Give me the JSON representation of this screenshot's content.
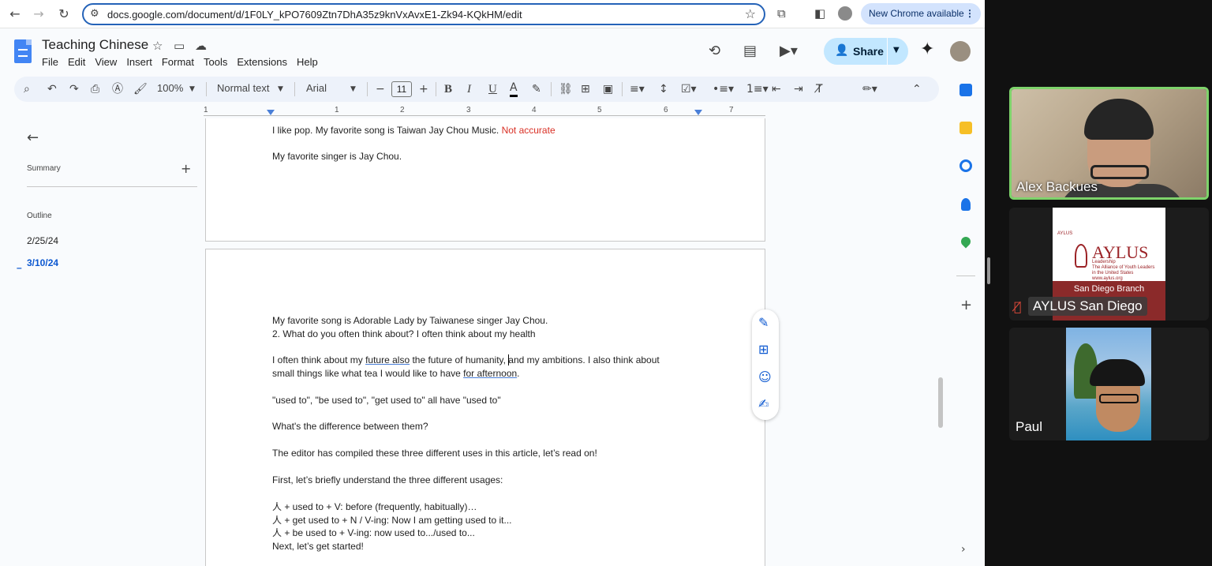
{
  "browser": {
    "url": "docs.google.com/document/d/1F0LY_kPO7609Ztn7DhA35z9knVxAvxE1-Zk94-KQkHM/edit",
    "new_chrome_label": "New Chrome available"
  },
  "doc": {
    "title": "Teaching Chinese",
    "menu": [
      "File",
      "Edit",
      "View",
      "Insert",
      "Format",
      "Tools",
      "Extensions",
      "Help"
    ],
    "share_label": "Share"
  },
  "toolbar": {
    "zoom": "100%",
    "style": "Normal text",
    "font": "Arial",
    "font_size": "11",
    "bold": "B",
    "italic": "I",
    "underline": "U",
    "text_color": "A"
  },
  "ruler": {
    "numbers": [
      "1",
      "1",
      "2",
      "3",
      "4",
      "5",
      "6",
      "7"
    ]
  },
  "outline": {
    "summary_label": "Summary",
    "outline_label": "Outline",
    "items": [
      "2/25/24",
      "3/10/24"
    ],
    "active_index": 1
  },
  "page1": {
    "line1": "I like pop. My favorite song is Taiwan Jay Chou Music. ",
    "line1_red": "Not accurate",
    "line2": "My favorite singer is Jay Chou."
  },
  "page2": {
    "l1": "My favorite song is Adorable Lady by Taiwanese singer Jay Chou.",
    "l2": "2. What do you often think about? I often think about my health",
    "l3a": "I often think about my ",
    "l3b": "future also",
    "l3c": " the future of humanity, and my ambitions. I also think about",
    "l4a": "small things like what tea I would like to have ",
    "l4b": "for afternoon",
    "l4c": ".",
    "l5": "\"used to\", \"be used to\", \"get used to\" all have \"used to\"",
    "l6": "What's the difference between them?",
    "l7": "The editor has compiled these three different uses in this article, let’s read on!",
    "l8": "First, let’s briefly understand the three different usages:",
    "l9": "人 + used to + V: before (frequently, habitually)…",
    "l10": "人 + get used to + N / V-ing: Now I am getting used to it...",
    "l11": "人 + be used to + V-ing: now used to.../used to...",
    "l12": "Next, let’s get started!"
  },
  "meeting": {
    "participants": [
      {
        "name": "Alex Backues",
        "speaking": true
      },
      {
        "name": "AYLUS San Diego",
        "muted": true
      },
      {
        "name": "Paul"
      }
    ],
    "aylus_card": {
      "logo": "AYLUS",
      "small": "AYLUS",
      "tagline1": "Leadership",
      "tagline2": "The Alliance of Youth Leaders",
      "tagline3": "in the United States",
      "website": "www.aylus.org",
      "branch": "San Diego Branch"
    }
  },
  "colors": {
    "accent": "#0b57d0",
    "share_bg": "#c2e7ff",
    "error_red": "#d93025",
    "speaking_border": "#7ed36b"
  }
}
